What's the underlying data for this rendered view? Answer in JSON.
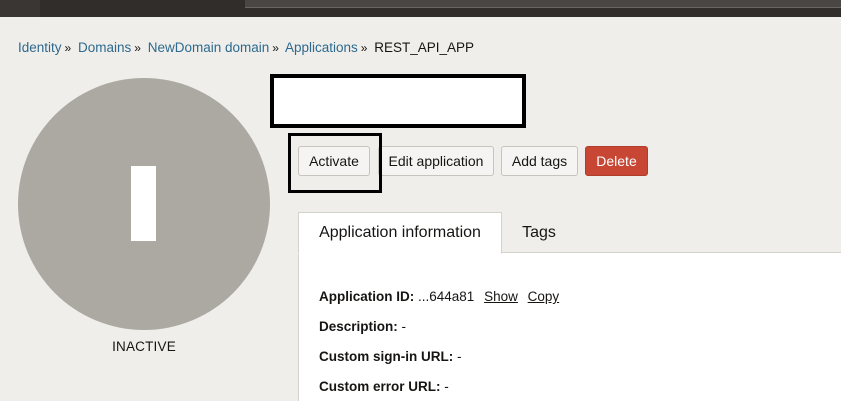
{
  "breadcrumb": {
    "items": [
      "Identity",
      "Domains",
      "NewDomain domain",
      "Applications"
    ],
    "separator": "»",
    "current": "REST_API_APP"
  },
  "avatar": {
    "letter": "I",
    "status": "INACTIVE",
    "color": "#aca8a2"
  },
  "actions": {
    "activate_label": "Activate",
    "edit_label": "Edit application",
    "add_tags_label": "Add tags",
    "delete_label": "Delete",
    "delete_color": "#c74634"
  },
  "tabs": [
    {
      "label": "Application information",
      "active": true
    },
    {
      "label": "Tags",
      "active": false
    }
  ],
  "info": {
    "app_id_label": "Application ID:",
    "app_id_value": "...644a81",
    "show_label": "Show",
    "copy_label": "Copy",
    "description_label": "Description:",
    "description_value": "-",
    "signin_label": "Custom sign-in URL:",
    "signin_value": "-",
    "error_label": "Custom error URL:",
    "error_value": "-"
  }
}
